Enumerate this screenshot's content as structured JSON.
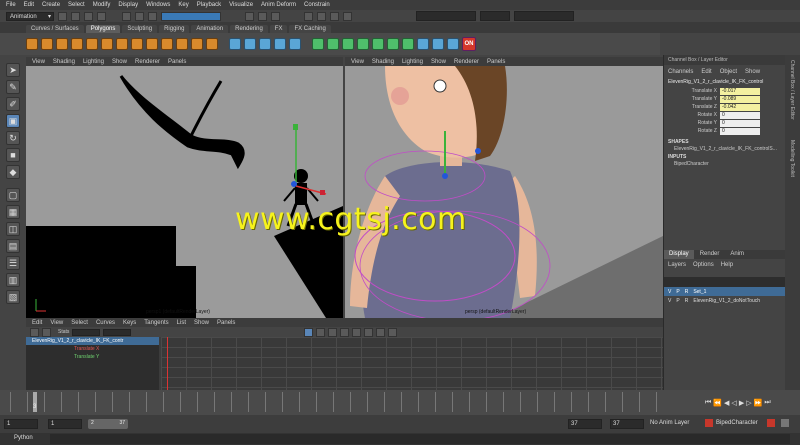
{
  "menubar": [
    "File",
    "Edit",
    "Create",
    "Select",
    "Modify",
    "Display",
    "Windows",
    "Key",
    "Playback",
    "Visualize",
    "Anim Deform",
    "Constrain"
  ],
  "status": {
    "mode": "Animation"
  },
  "shelf_tabs": [
    "Curves / Surfaces",
    "Polygons",
    "Sculpting",
    "Rigging",
    "Animation",
    "Rendering",
    "FX",
    "FX Caching"
  ],
  "active_shelf_tab": "Polygons",
  "shelf_badge": "ON",
  "viewport_menu": [
    "View",
    "Shading",
    "Lighting",
    "Show",
    "Renderer",
    "Panels"
  ],
  "viewport_left_label": "persp1 (defaultRenderLayer)",
  "viewport_right_label": "persp (defaultRenderLayer)",
  "watermark": "www.cgtsj.com",
  "channel_box": {
    "title": "Channel Box / Layer Editor",
    "menu": [
      "Channels",
      "Edit",
      "Object",
      "Show"
    ],
    "node": "ElevenRig_V1_2_r_clavicle_IK_FK_control",
    "attrs": [
      {
        "name": "Translate X",
        "value": "-0.017"
      },
      {
        "name": "Translate Y",
        "value": "-0.089"
      },
      {
        "name": "Translate Z",
        "value": "-0.042"
      },
      {
        "name": "Rotate X",
        "value": "0"
      },
      {
        "name": "Rotate Y",
        "value": "0"
      },
      {
        "name": "Rotate Z",
        "value": "0"
      }
    ],
    "shapes_header": "SHAPES",
    "shape": "ElevenRig_V1_2_r_clavicle_IK_FK_controlS...",
    "inputs_header": "INPUTS",
    "input": "BipedCharacter"
  },
  "layer_editor": {
    "tabs": [
      "Display",
      "Render",
      "Anim"
    ],
    "menu": [
      "Layers",
      "Options",
      "Help"
    ],
    "layers": [
      {
        "v": "V",
        "p": "P",
        "r": "R",
        "name": "Set_1"
      },
      {
        "v": "V",
        "p": "P",
        "r": "R",
        "name": "ElevenRig_V1_2_doNotTouch"
      }
    ]
  },
  "side_tabs": [
    "Channel Box / Layer Editor",
    "Modelling Toolkit"
  ],
  "graph_editor": {
    "menu": [
      "Edit",
      "View",
      "Select",
      "Curves",
      "Keys",
      "Tangents",
      "List",
      "Show",
      "Panels"
    ],
    "stats": "Stats",
    "outliner_item": "ElevenRig_V1_2_r_clavicle_IK_FK_contr",
    "curves": [
      "Translate X",
      "Translate Y"
    ]
  },
  "timeline": {
    "current_frame": "3"
  },
  "range": {
    "start": "1",
    "inner_start": "1",
    "start2": "2",
    "end_inner": "37",
    "end": "37",
    "end2": "37",
    "anim_layer": "No Anim Layer",
    "char_set": "BipedCharacter"
  },
  "cmdline": {
    "label": "Python"
  },
  "colors": {
    "accent": "#5a86b8",
    "watermark": "#f6f31d",
    "highlight": "#f3f0a0",
    "layer_selected": "#3f6b96"
  }
}
